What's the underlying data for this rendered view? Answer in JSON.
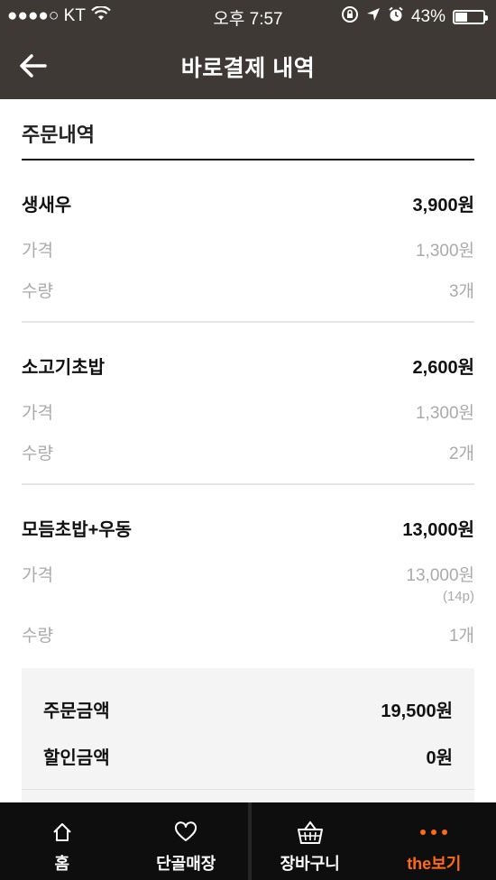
{
  "status_bar": {
    "carrier": "●●●●○ KT",
    "time": "오후 7:57",
    "battery": "43%",
    "battery_level": 0.43,
    "icons": [
      "wifi-icon",
      "rotation-lock-icon",
      "location-arrow-icon",
      "alarm-icon",
      "battery-icon"
    ]
  },
  "nav": {
    "title": "바로결제 내역",
    "back_icon": "back-arrow-icon"
  },
  "order": {
    "section_title": "주문내역",
    "price_label": "가격",
    "qty_label": "수량",
    "items": [
      {
        "name": "생새우",
        "total": "3,900원",
        "price": "1,300원",
        "qty": "3개"
      },
      {
        "name": "소고기초밥",
        "total": "2,600원",
        "price": "1,300원",
        "qty": "2개"
      },
      {
        "name": "모듬초밥+우동",
        "total": "13,000원",
        "price": "13,000원",
        "points": "(14p)",
        "qty": "1개"
      }
    ]
  },
  "summary": {
    "order_amount_label": "주문금액",
    "order_amount": "19,500원",
    "discount_label": "할인금액",
    "discount": "0원"
  },
  "tabbar": {
    "tabs": [
      {
        "label": "홈",
        "icon": "home-icon"
      },
      {
        "label": "단골매장",
        "icon": "heart-icon"
      },
      {
        "label": "장바구니",
        "icon": "basket-icon"
      },
      {
        "label": "the보기",
        "icon": "more-dots-icon",
        "active": true
      }
    ],
    "active_color": "#ff6a13"
  },
  "colors": {
    "header_bg": "#3e3934",
    "tabbar_bg": "#0e0e0e",
    "accent": "#ff6a13"
  }
}
